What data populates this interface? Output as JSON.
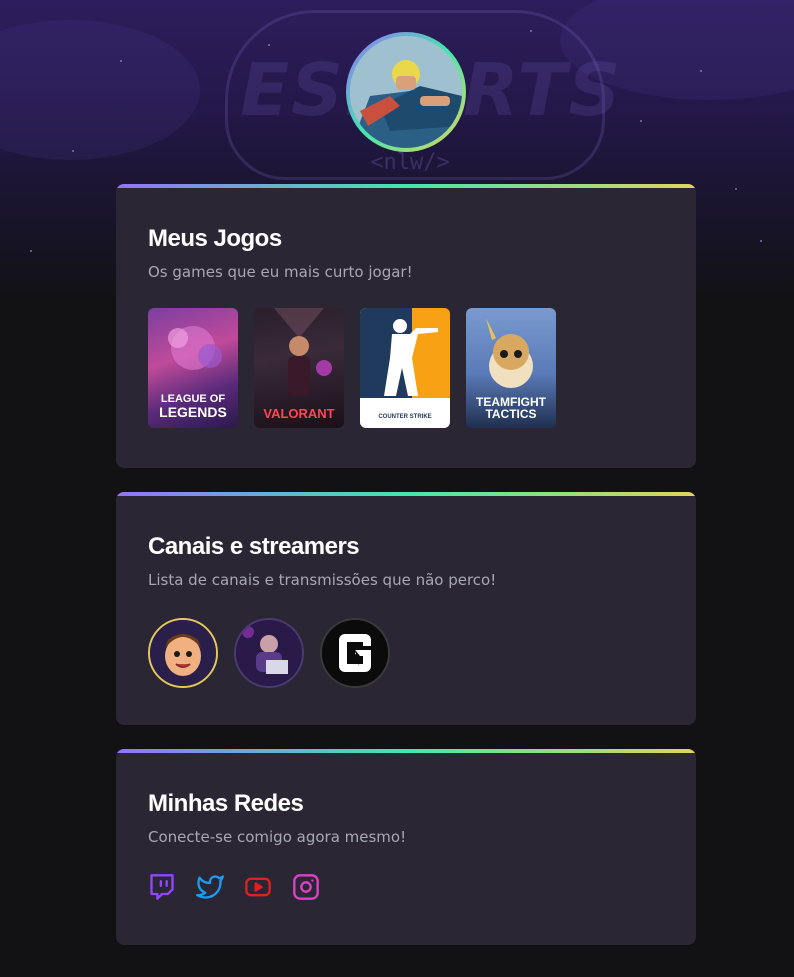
{
  "hero": {
    "logo_text": "ESPORTS",
    "logo_subtext": "<nlw/>"
  },
  "profile": {
    "avatar_alt": "profile photo"
  },
  "games_section": {
    "title": "Meus Jogos",
    "subtitle": "Os games que eu mais curto jogar!",
    "games": [
      {
        "name_line1": "LEAGUE OF",
        "name_line2": "LEGENDS",
        "icon": "league-of-legends-cover"
      },
      {
        "name_line1": "VALORANT",
        "name_line2": "",
        "icon": "valorant-cover"
      },
      {
        "name_line1": "COUNTER STRIKE",
        "name_line2": "",
        "icon": "counter-strike-cover"
      },
      {
        "name_line1": "TEAMFIGHT",
        "name_line2": "TACTICS",
        "icon": "teamfight-tactics-cover"
      }
    ]
  },
  "channels_section": {
    "title": "Canais e streamers",
    "subtitle": "Lista de canais e transmissões que não perco!",
    "channels": [
      {
        "icon": "streamer-cartoon-avatar"
      },
      {
        "icon": "streamer-photo-avatar"
      },
      {
        "icon": "rainbow-six-logo"
      }
    ]
  },
  "social_section": {
    "title": "Minhas Redes",
    "subtitle": "Conecte-se comigo agora mesmo!",
    "networks": [
      {
        "icon": "twitch-icon",
        "color": "#9147ff"
      },
      {
        "icon": "twitter-icon",
        "color": "#1d9bf0"
      },
      {
        "icon": "youtube-icon",
        "color": "#e02020"
      },
      {
        "icon": "instagram-icon",
        "color": "#e040c8"
      }
    ]
  },
  "colors": {
    "background": "#121214",
    "card": "#2a2634",
    "gradient_start": "#9572fc",
    "gradient_mid": "#43e7ad",
    "gradient_end": "#e2d45c"
  }
}
